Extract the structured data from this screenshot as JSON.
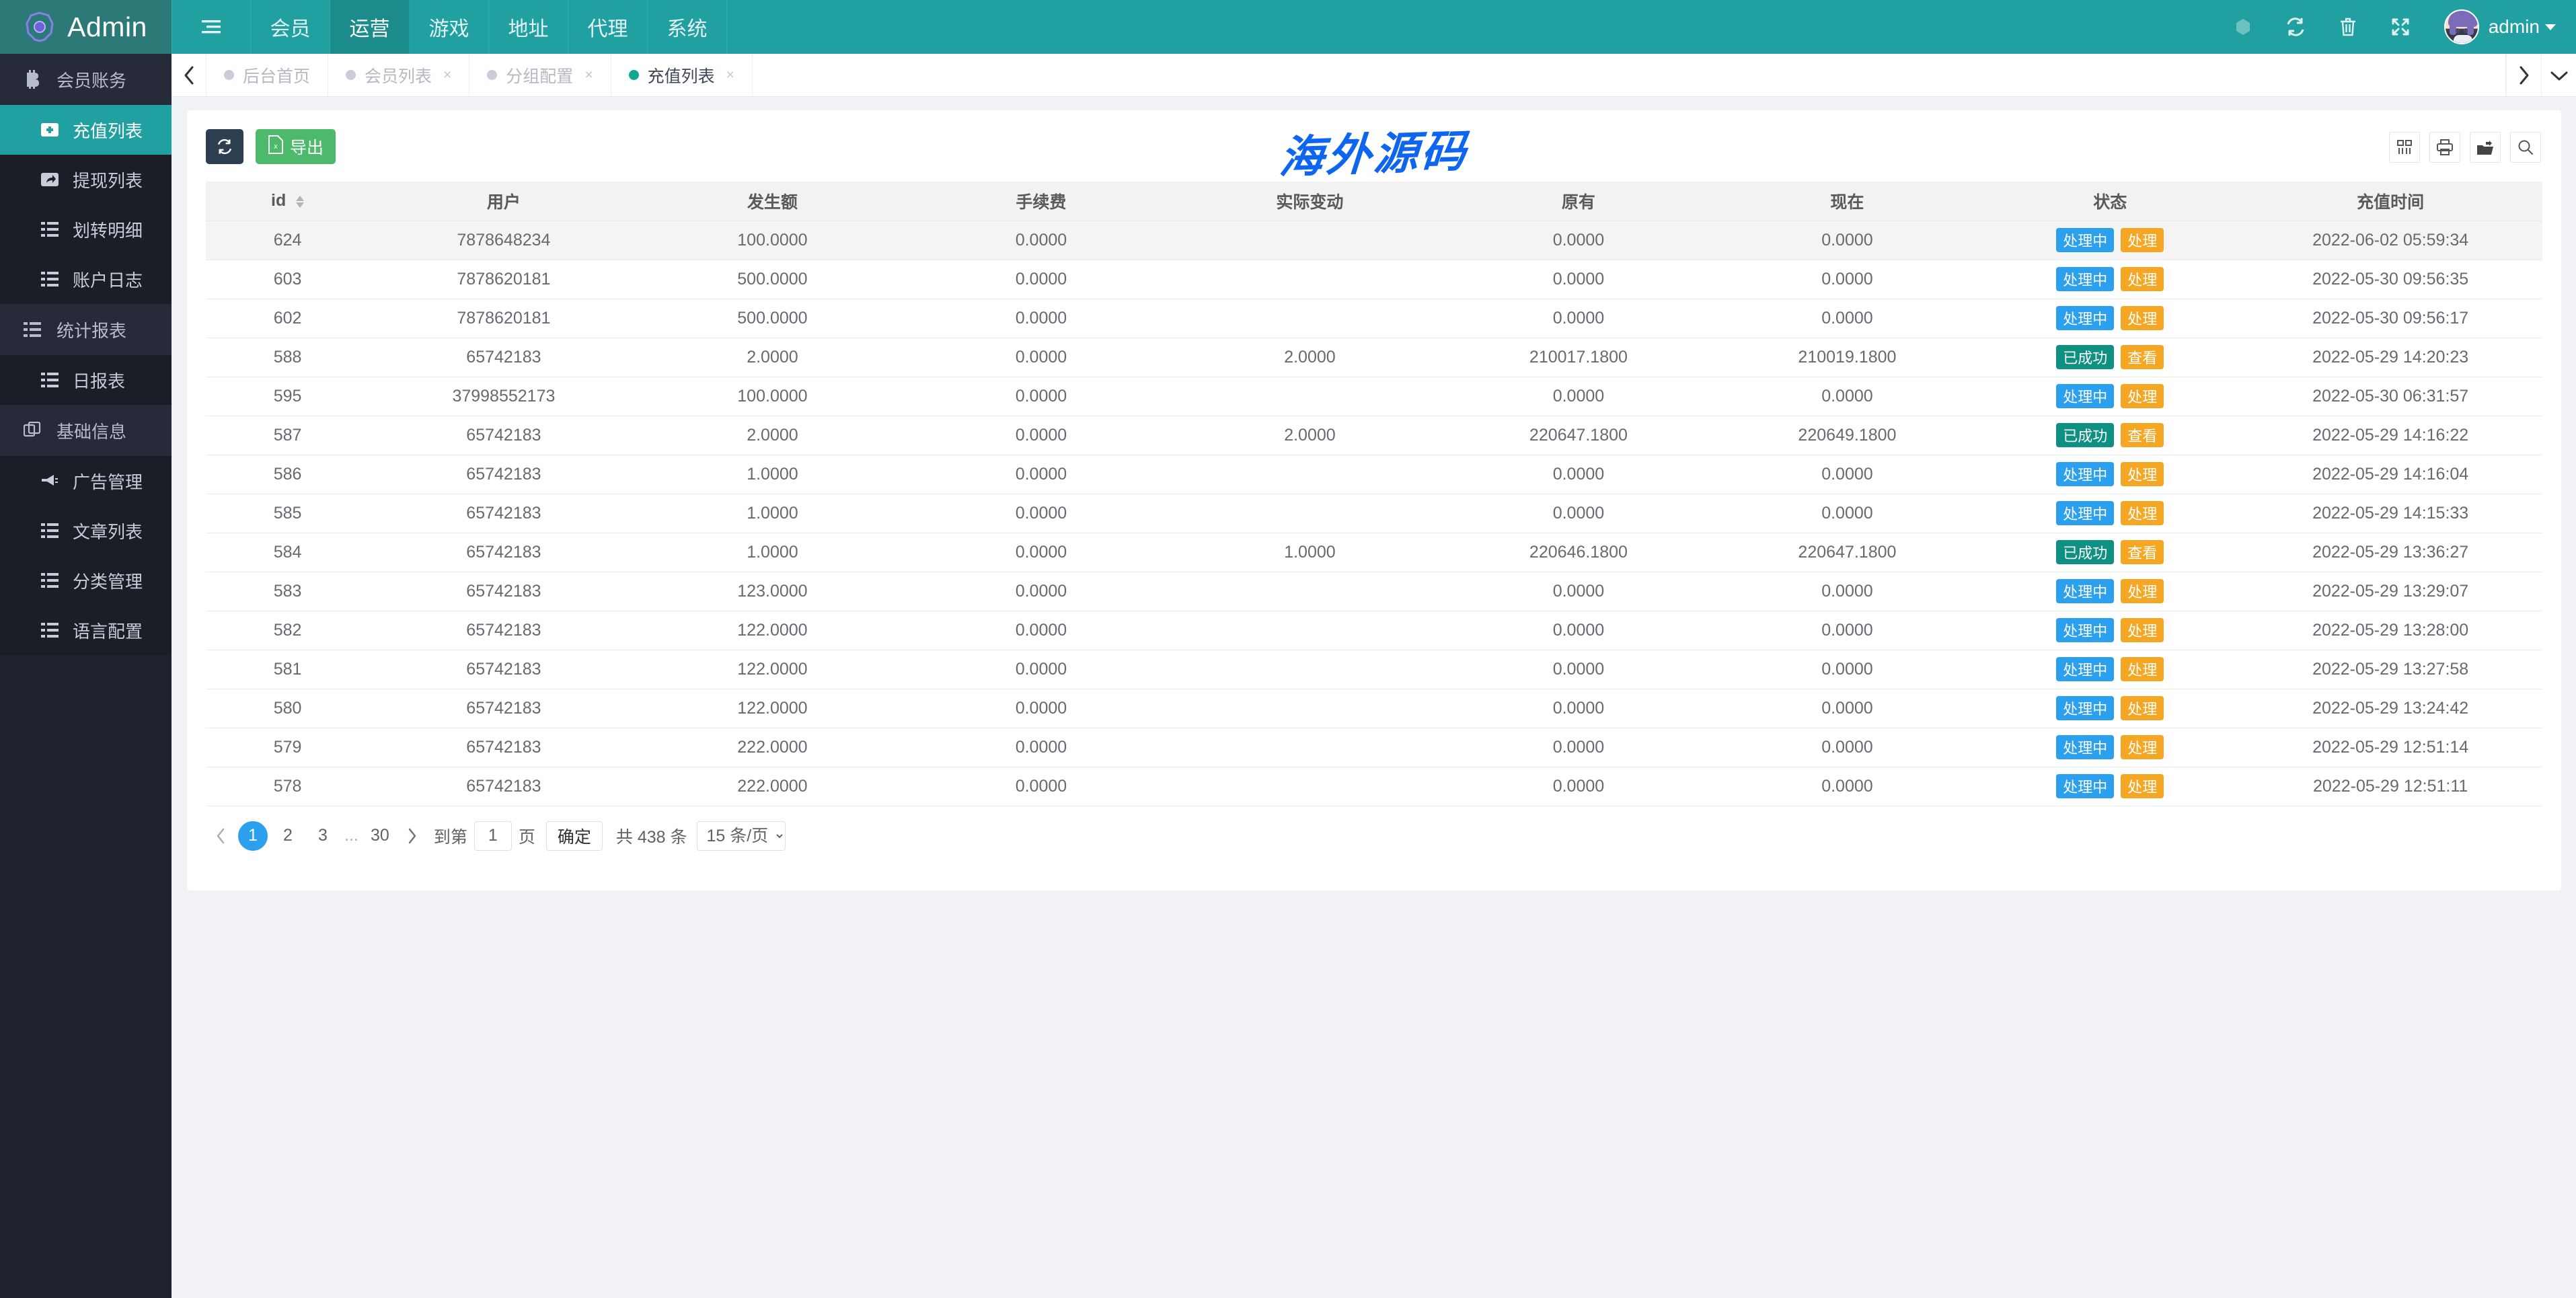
{
  "header": {
    "brand": "Admin",
    "brand_logo_icon": "hexagon-orb-logo",
    "menu_toggle_icon": "list-menu-icon",
    "nav": [
      {
        "label": "会员",
        "active": false
      },
      {
        "label": "运营",
        "active": true
      },
      {
        "label": "游戏",
        "active": false
      },
      {
        "label": "地址",
        "active": false
      },
      {
        "label": "代理",
        "active": false
      },
      {
        "label": "系统",
        "active": false
      }
    ],
    "right_icons": [
      "snowflake-icon",
      "refresh-icon",
      "trash-icon",
      "fullscreen-icon"
    ],
    "avatar_name": "avatar",
    "username": "admin",
    "user_caret_icon": "caret-down-icon"
  },
  "sidebar": {
    "groups": [
      {
        "label": "会员账务",
        "icon": "bitcoin-icon",
        "items": [
          {
            "label": "充值列表",
            "icon": "plus-square-icon",
            "active": true
          },
          {
            "label": "提现列表",
            "icon": "share-square-icon",
            "active": false
          },
          {
            "label": "划转明细",
            "icon": "list-icon",
            "active": false
          },
          {
            "label": "账户日志",
            "icon": "list-icon",
            "active": false
          }
        ]
      },
      {
        "label": "统计报表",
        "icon": "list-icon",
        "items": [
          {
            "label": "日报表",
            "icon": "list-icon",
            "active": false
          }
        ]
      },
      {
        "label": "基础信息",
        "icon": "copy-icon",
        "items": [
          {
            "label": "广告管理",
            "icon": "ad-icon",
            "active": false
          },
          {
            "label": "文章列表",
            "icon": "list-icon",
            "active": false
          },
          {
            "label": "分类管理",
            "icon": "list-icon",
            "active": false
          },
          {
            "label": "语言配置",
            "icon": "list-icon",
            "active": false
          }
        ]
      }
    ]
  },
  "tabbar": {
    "left_arrow_icon": "chevron-left-icon",
    "right_arrow_icon": "chevron-right-icon",
    "dropdown_icon": "chevron-down-icon",
    "tabs": [
      {
        "label": "后台首页",
        "active": false,
        "closable": false
      },
      {
        "label": "会员列表",
        "active": false,
        "closable": true
      },
      {
        "label": "分组配置",
        "active": false,
        "closable": true
      },
      {
        "label": "充值列表",
        "active": true,
        "closable": true
      }
    ],
    "close_glyph": "×"
  },
  "toolbar": {
    "refresh_icon": "refresh-icon",
    "export_label": "导出",
    "export_icon": "excel-file-icon",
    "watermark": "海外源码",
    "watermark_color": "#0d65f0",
    "right_icons": [
      "columns-icon",
      "print-icon",
      "export-folder-icon",
      "search-icon"
    ]
  },
  "table": {
    "columns": [
      "id",
      "用户",
      "发生额",
      "手续费",
      "实际变动",
      "原有",
      "现在",
      "状态",
      "充值时间"
    ],
    "sortable_column": "id",
    "rows": [
      {
        "id": "624",
        "user": "7878648234",
        "amount": "100.0000",
        "fee": "0.0000",
        "change": "",
        "before": "0.0000",
        "after": "0.0000",
        "status": "处理中",
        "status_type": "blue",
        "action": "处理",
        "time": "2022-06-02 05:59:34"
      },
      {
        "id": "603",
        "user": "7878620181",
        "amount": "500.0000",
        "fee": "0.0000",
        "change": "",
        "before": "0.0000",
        "after": "0.0000",
        "status": "处理中",
        "status_type": "blue",
        "action": "处理",
        "time": "2022-05-30 09:56:35"
      },
      {
        "id": "602",
        "user": "7878620181",
        "amount": "500.0000",
        "fee": "0.0000",
        "change": "",
        "before": "0.0000",
        "after": "0.0000",
        "status": "处理中",
        "status_type": "blue",
        "action": "处理",
        "time": "2022-05-30 09:56:17"
      },
      {
        "id": "588",
        "user": "65742183",
        "amount": "2.0000",
        "fee": "0.0000",
        "change": "2.0000",
        "before": "210017.1800",
        "after": "210019.1800",
        "status": "已成功",
        "status_type": "green",
        "action": "查看",
        "time": "2022-05-29 14:20:23"
      },
      {
        "id": "595",
        "user": "37998552173",
        "amount": "100.0000",
        "fee": "0.0000",
        "change": "",
        "before": "0.0000",
        "after": "0.0000",
        "status": "处理中",
        "status_type": "blue",
        "action": "处理",
        "time": "2022-05-30 06:31:57"
      },
      {
        "id": "587",
        "user": "65742183",
        "amount": "2.0000",
        "fee": "0.0000",
        "change": "2.0000",
        "before": "220647.1800",
        "after": "220649.1800",
        "status": "已成功",
        "status_type": "green",
        "action": "查看",
        "time": "2022-05-29 14:16:22"
      },
      {
        "id": "586",
        "user": "65742183",
        "amount": "1.0000",
        "fee": "0.0000",
        "change": "",
        "before": "0.0000",
        "after": "0.0000",
        "status": "处理中",
        "status_type": "blue",
        "action": "处理",
        "time": "2022-05-29 14:16:04"
      },
      {
        "id": "585",
        "user": "65742183",
        "amount": "1.0000",
        "fee": "0.0000",
        "change": "",
        "before": "0.0000",
        "after": "0.0000",
        "status": "处理中",
        "status_type": "blue",
        "action": "处理",
        "time": "2022-05-29 14:15:33"
      },
      {
        "id": "584",
        "user": "65742183",
        "amount": "1.0000",
        "fee": "0.0000",
        "change": "1.0000",
        "before": "220646.1800",
        "after": "220647.1800",
        "status": "已成功",
        "status_type": "green",
        "action": "查看",
        "time": "2022-05-29 13:36:27"
      },
      {
        "id": "583",
        "user": "65742183",
        "amount": "123.0000",
        "fee": "0.0000",
        "change": "",
        "before": "0.0000",
        "after": "0.0000",
        "status": "处理中",
        "status_type": "blue",
        "action": "处理",
        "time": "2022-05-29 13:29:07"
      },
      {
        "id": "582",
        "user": "65742183",
        "amount": "122.0000",
        "fee": "0.0000",
        "change": "",
        "before": "0.0000",
        "after": "0.0000",
        "status": "处理中",
        "status_type": "blue",
        "action": "处理",
        "time": "2022-05-29 13:28:00"
      },
      {
        "id": "581",
        "user": "65742183",
        "amount": "122.0000",
        "fee": "0.0000",
        "change": "",
        "before": "0.0000",
        "after": "0.0000",
        "status": "处理中",
        "status_type": "blue",
        "action": "处理",
        "time": "2022-05-29 13:27:58"
      },
      {
        "id": "580",
        "user": "65742183",
        "amount": "122.0000",
        "fee": "0.0000",
        "change": "",
        "before": "0.0000",
        "after": "0.0000",
        "status": "处理中",
        "status_type": "blue",
        "action": "处理",
        "time": "2022-05-29 13:24:42"
      },
      {
        "id": "579",
        "user": "65742183",
        "amount": "222.0000",
        "fee": "0.0000",
        "change": "",
        "before": "0.0000",
        "after": "0.0000",
        "status": "处理中",
        "status_type": "blue",
        "action": "处理",
        "time": "2022-05-29 12:51:14"
      },
      {
        "id": "578",
        "user": "65742183",
        "amount": "222.0000",
        "fee": "0.0000",
        "change": "",
        "before": "0.0000",
        "after": "0.0000",
        "status": "处理中",
        "status_type": "blue",
        "action": "处理",
        "time": "2022-05-29 12:51:11"
      }
    ]
  },
  "pagination": {
    "prev_icon": "chevron-left-icon",
    "next_icon": "chevron-right-icon",
    "pages": [
      "1",
      "2",
      "3"
    ],
    "ellipsis": "...",
    "last_page": "30",
    "current_page": "1",
    "goto_label": "到第",
    "goto_value": "1",
    "page_unit": "页",
    "confirm_label": "确定",
    "total_label": "共 438 条",
    "page_size": "15 条/页",
    "page_size_caret_icon": "chevron-down-icon"
  },
  "colors": {
    "brand_teal": "#20a0a0",
    "sidebar_dark": "#20222e",
    "status_blue": "#2aa0ef",
    "status_green": "#0e9183",
    "action_orange": "#f5a623",
    "export_green": "#4cb96b",
    "refresh_dark": "#2c3e50"
  }
}
